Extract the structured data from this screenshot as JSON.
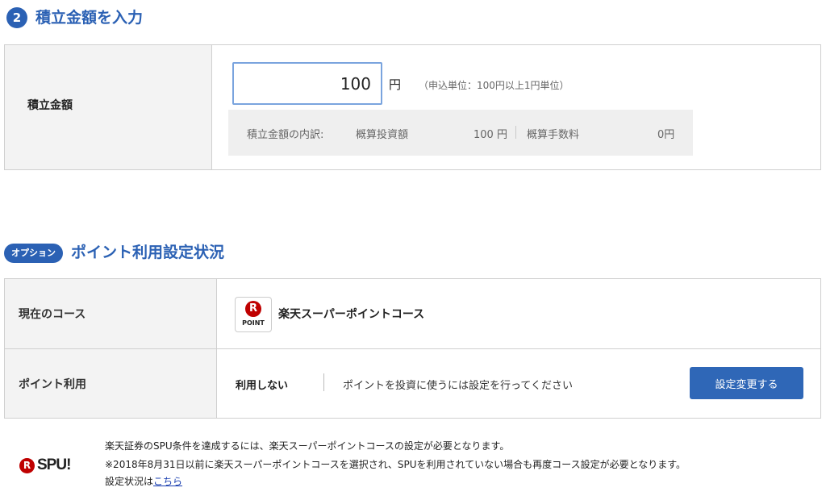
{
  "section2": {
    "number": "2",
    "title": "積立金額を入力",
    "amount_label": "積立金額",
    "amount_value": "100",
    "yen_unit": "円",
    "unit_note": "（申込単位：100円以上1円単位）",
    "breakdown": {
      "label": "積立金額の内訳:",
      "invest_label": "概算投資額",
      "invest_value": "100 円",
      "fee_label": "概算手数料",
      "fee_value": "0円"
    }
  },
  "option_section": {
    "badge": "オプション",
    "title": "ポイント利用設定状況",
    "course_label": "現在のコース",
    "point_logo_letter": "R",
    "point_logo_text": "POINT",
    "course_name": "楽天スーパーポイントコース",
    "use_label": "ポイント利用",
    "use_value": "利用しない",
    "use_note": "ポイントを投資に使うには設定を行ってください",
    "change_button": "設定変更する"
  },
  "spu": {
    "logo_letter": "R",
    "logo_text": "SPU!",
    "line1": "楽天証券のSPU条件を達成するには、楽天スーパーポイントコースの設定が必要となります。",
    "line2": "※2018年8月31日以前に楽天スーパーポイントコースを選択され、SPUを利用されていない場合も再度コース設定が必要となります。",
    "line3_prefix": "設定状況は",
    "line3_link": "こちら"
  },
  "colors": {
    "accent": "#2b61b4",
    "brand_red": "#bf0000",
    "button": "#2f67b7",
    "link": "#1a3fb0"
  }
}
